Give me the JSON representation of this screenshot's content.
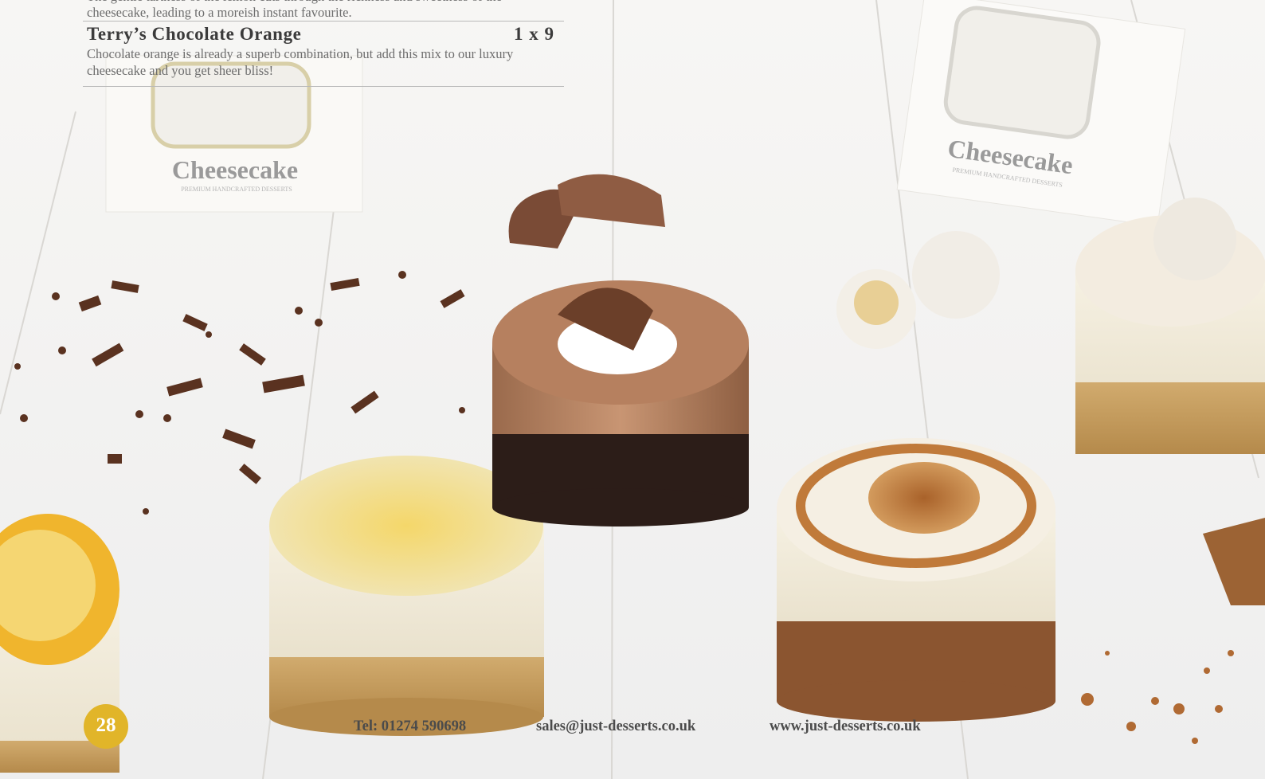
{
  "previous_item": {
    "description": "The gentle tartness of the lemon cuts through the richness and sweetness of the cheesecake, leading to a moreish instant favourite."
  },
  "product": {
    "name": "Terry’s Chocolate Orange",
    "quantity": "1 x 9",
    "description": "Chocolate orange is already a superb combination, but add this mix to our luxury cheesecake and you get sheer bliss!"
  },
  "photo": {
    "box_label": "Cheesecake",
    "box_sublabel": "PREMIUM HANDCRAFTED DESSERTS"
  },
  "footer": {
    "page_number": "28",
    "telephone": "Tel: 01274 590698",
    "email": "sales@just-desserts.co.uk",
    "website": "www.just-desserts.co.uk"
  },
  "colors": {
    "badge": "#e1b529",
    "heading": "#3b3b3b",
    "body_text": "#6d6d6d"
  }
}
